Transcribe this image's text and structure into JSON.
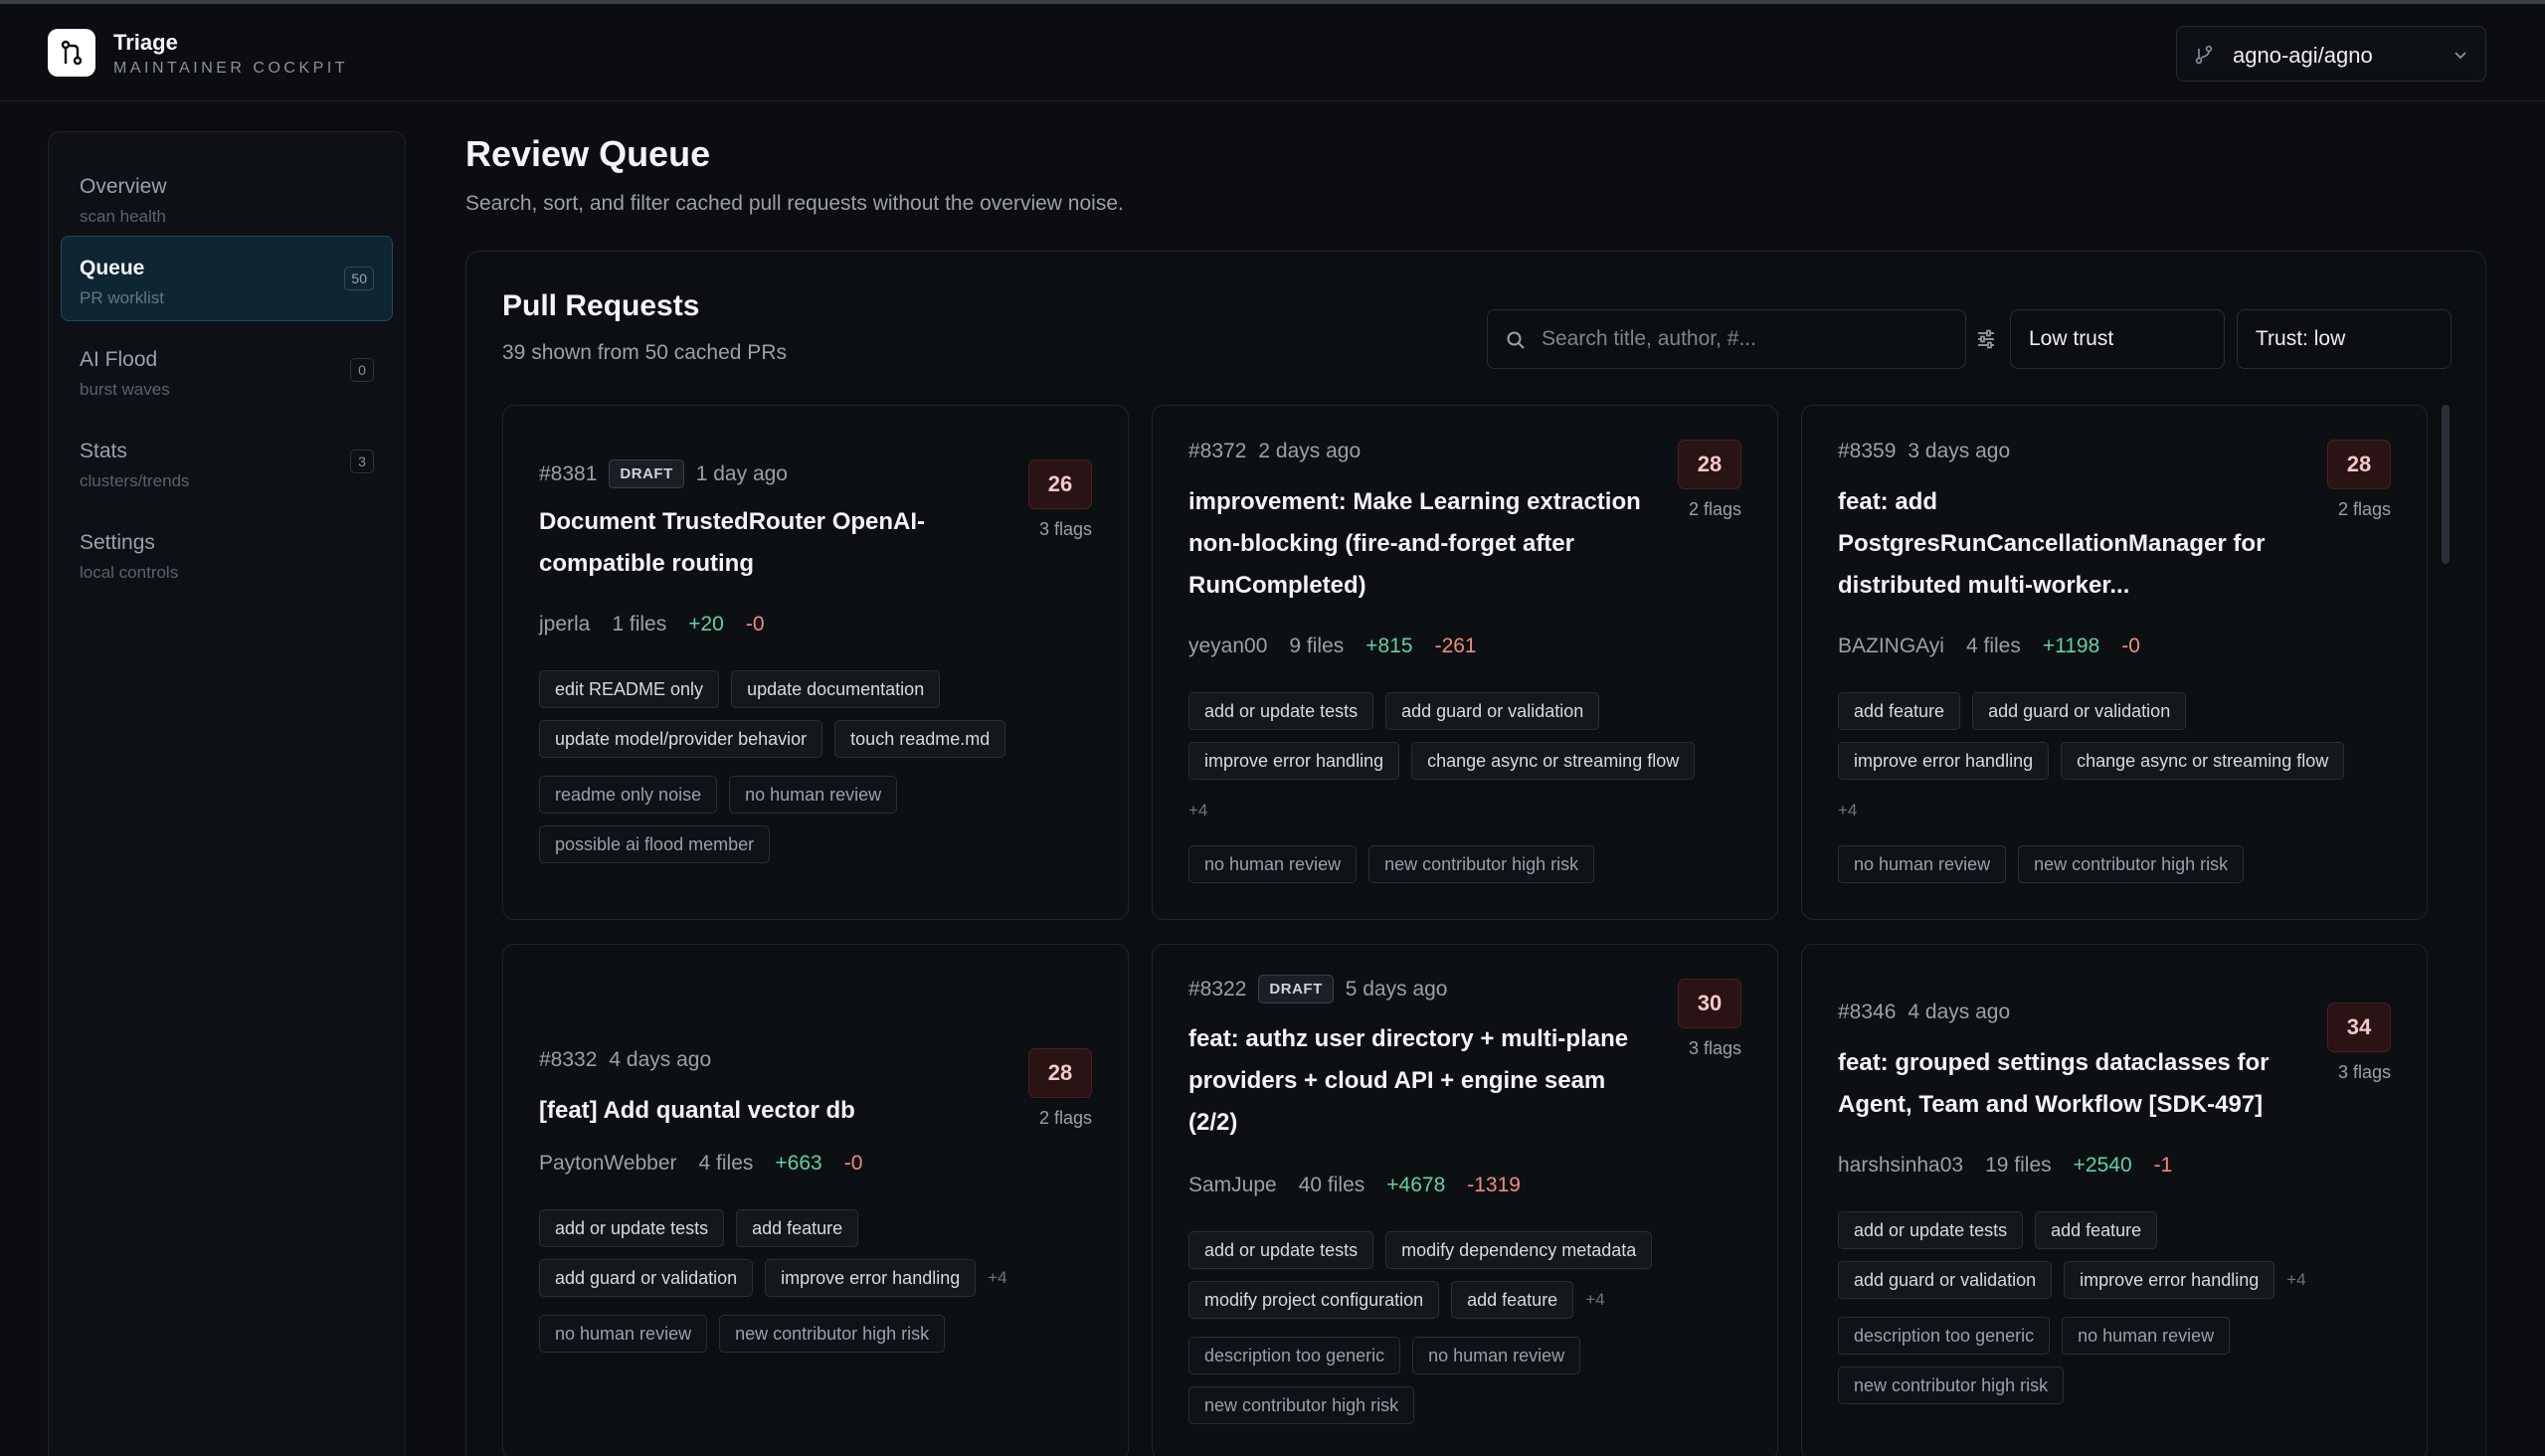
{
  "app": {
    "title": "Triage",
    "subtitle": "MAINTAINER COCKPIT",
    "repo": "agno-agi/agno"
  },
  "sidebar": {
    "items": [
      {
        "label": "Overview",
        "sub": "scan health",
        "count": null,
        "active": false
      },
      {
        "label": "Queue",
        "sub": "PR worklist",
        "count": "50",
        "active": true
      },
      {
        "label": "AI Flood",
        "sub": "burst waves",
        "count": "0",
        "active": false
      },
      {
        "label": "Stats",
        "sub": "clusters/trends",
        "count": "3",
        "active": false
      },
      {
        "label": "Settings",
        "sub": "local controls",
        "count": null,
        "active": false
      }
    ]
  },
  "page": {
    "title": "Review Queue",
    "description": "Search, sort, and filter cached pull requests without the overview noise."
  },
  "panel": {
    "title": "Pull Requests",
    "subtitle": "39 shown from 50 cached PRs",
    "search_placeholder": "Search title, author, #...",
    "filter_trust": "Low trust",
    "filter_sort": "Trust: low"
  },
  "cards": [
    {
      "number": "#8381",
      "draft": "DRAFT",
      "age": "1 day ago",
      "title": "Document TrustedRouter OpenAI-compatible routing",
      "score": "26",
      "flags": "3 flags",
      "author": "jperla",
      "files": "1 files",
      "additions": "+20",
      "deletions": "-0",
      "tags": [
        "edit README only",
        "update documentation",
        "update model/provider behavior",
        "touch readme.md"
      ],
      "more": "",
      "flag_tags": [
        "readme only noise",
        "no human review",
        "possible ai flood member"
      ]
    },
    {
      "number": "#8372",
      "draft": "",
      "age": "2 days ago",
      "title": "improvement: Make Learning extraction non-blocking (fire-and-forget after RunCompleted)",
      "score": "28",
      "flags": "2 flags",
      "author": "yeyan00",
      "files": "9 files",
      "additions": "+815",
      "deletions": "-261",
      "tags": [
        "add or update tests",
        "add guard or validation",
        "improve error handling",
        "change async or streaming flow"
      ],
      "more": "+4",
      "flag_tags": [
        "no human review",
        "new contributor high risk"
      ]
    },
    {
      "number": "#8359",
      "draft": "",
      "age": "3 days ago",
      "title": "feat: add PostgresRunCancellationManager for distributed multi-worker...",
      "score": "28",
      "flags": "2 flags",
      "author": "BAZINGAyi",
      "files": "4 files",
      "additions": "+1198",
      "deletions": "-0",
      "tags": [
        "add feature",
        "add guard or validation",
        "improve error handling",
        "change async or streaming flow"
      ],
      "more": "+4",
      "flag_tags": [
        "no human review",
        "new contributor high risk"
      ]
    },
    {
      "number": "#8332",
      "draft": "",
      "age": "4 days ago",
      "title": "[feat] Add quantal vector db",
      "score": "28",
      "flags": "2 flags",
      "author": "PaytonWebber",
      "files": "4 files",
      "additions": "+663",
      "deletions": "-0",
      "tags": [
        "add or update tests",
        "add feature",
        "add guard or validation",
        "improve error handling"
      ],
      "more": "+4",
      "flag_tags": [
        "no human review",
        "new contributor high risk"
      ]
    },
    {
      "number": "#8322",
      "draft": "DRAFT",
      "age": "5 days ago",
      "title": "feat: authz user directory + multi-plane providers + cloud API + engine seam (2/2)",
      "score": "30",
      "flags": "3 flags",
      "author": "SamJupe",
      "files": "40 files",
      "additions": "+4678",
      "deletions": "-1319",
      "tags": [
        "add or update tests",
        "modify dependency metadata",
        "modify project configuration",
        "add feature"
      ],
      "more": "+4",
      "flag_tags": [
        "description too generic",
        "no human review",
        "new contributor high risk"
      ]
    },
    {
      "number": "#8346",
      "draft": "",
      "age": "4 days ago",
      "title": "feat: grouped settings dataclasses for Agent, Team and Workflow [SDK-497]",
      "score": "34",
      "flags": "3 flags",
      "author": "harshsinha03",
      "files": "19 files",
      "additions": "+2540",
      "deletions": "-1",
      "tags": [
        "add or update tests",
        "add feature",
        "add guard or validation",
        "improve error handling"
      ],
      "more": "+4",
      "flag_tags": [
        "description too generic",
        "no human review",
        "new contributor high risk"
      ]
    }
  ]
}
